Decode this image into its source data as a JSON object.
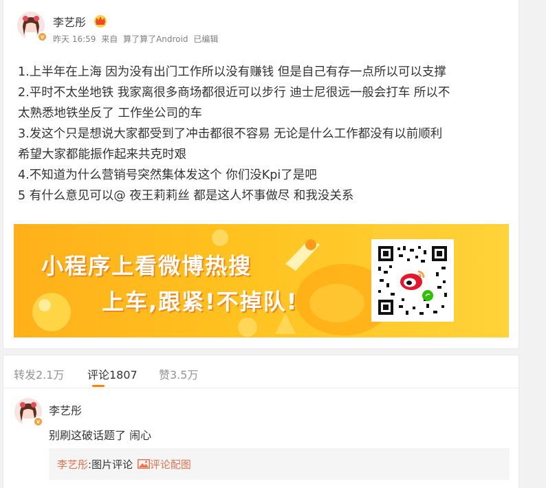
{
  "post": {
    "author": "李艺彤",
    "time": "昨天 16:59",
    "source_prefix": "来自",
    "source": "算了算了Android",
    "edited": "已编辑",
    "lines": [
      "1.上半年在上海 因为没有出门工作所以没有赚钱 但是自己有存一点所以可以支撑",
      "2.平时不太坐地铁 我家离很多商场都很近可以步行 迪士尼很远一般会打车 所以不",
      "太熟悉地铁坐反了 工作坐公司的车",
      "3.发这个只是想说大家都受到了冲击都很不容易 无论是什么工作都没有以前顺利",
      "希望大家都能振作起来共克时艰",
      "4.不知道为什么营销号突然集体发这个 你们没Kpi了是吧",
      "5 有什么意见可以@ 夜王莉莉丝 都是这人坏事做尽 和我没关系"
    ]
  },
  "banner": {
    "line1": "小程序上看微博热搜",
    "line2": "上车,跟紧!不掉队!"
  },
  "tabs": {
    "repost": "转发2.1万",
    "comment": "评论1807",
    "like": "赞3.5万"
  },
  "comment": {
    "author": "李艺彤",
    "text": "别刷这破话题了 闹心",
    "quote_user": "李艺彤",
    "quote_label": ":图片评论",
    "quote_link": "评论配图"
  },
  "icons": {
    "crown": "crown-icon",
    "verified": "verified-badge-icon",
    "image": "image-icon"
  },
  "colors": {
    "accent": "#ff8200",
    "link": "#eb7350",
    "banner": "#ffb01a"
  }
}
